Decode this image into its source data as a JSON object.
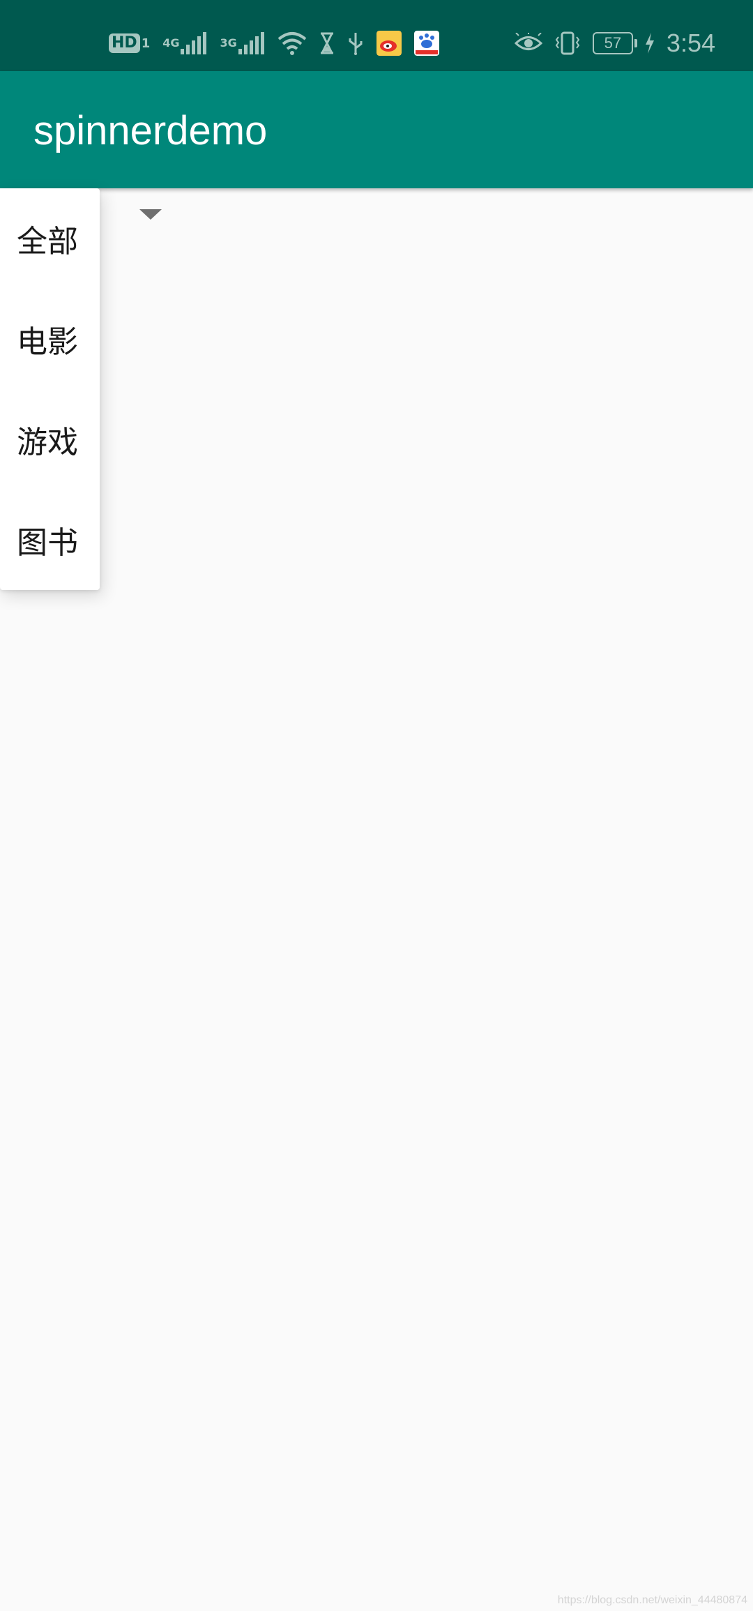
{
  "status_bar": {
    "hd_label": "HD",
    "sim_slot": "1",
    "network_1": "4G",
    "network_2": "3G",
    "battery_level": "57",
    "time": "3:54",
    "icons": [
      "hd-icon",
      "signal-4g-icon",
      "signal-3g-icon",
      "wifi-icon",
      "hourglass-icon",
      "usb-icon",
      "weibo-app-icon",
      "baidu-app-icon",
      "eye-comfort-icon",
      "vibrate-icon",
      "battery-icon",
      "charging-icon"
    ]
  },
  "app_bar": {
    "title": "spinnerdemo",
    "color": "#00877a"
  },
  "spinner": {
    "options": [
      "全部",
      "电影",
      "游戏",
      "图书"
    ]
  },
  "watermark": "https://blog.csdn.net/weixin_44480874",
  "colors": {
    "status_bar": "#00594f",
    "primary": "#00877a",
    "background": "#fafafa"
  }
}
